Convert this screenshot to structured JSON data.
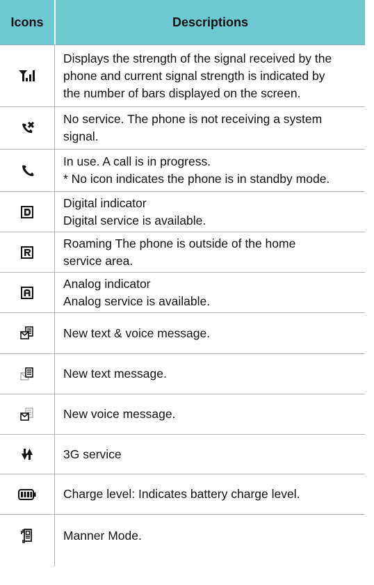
{
  "header": {
    "icons": "Icons",
    "descriptions": "Descriptions"
  },
  "rows": [
    {
      "icon": "signal-strength-icon",
      "lines": [
        "Displays the strength of the signal received by the",
        "phone and current signal strength is indicated by",
        "the number of bars displayed on the screen."
      ]
    },
    {
      "icon": "no-service-icon",
      "lines": [
        "No service. The phone is not receiving a system",
        "signal."
      ]
    },
    {
      "icon": "call-in-use-icon",
      "lines": [
        "In use. A call is in progress.",
        "* No icon indicates the phone is in standby mode."
      ]
    },
    {
      "icon": "digital-indicator-icon",
      "lines": [
        "Digital indicator",
        "Digital service is available."
      ]
    },
    {
      "icon": "roaming-icon",
      "lines": [
        "Roaming The phone is outside of the home",
        "service area."
      ]
    },
    {
      "icon": "analog-indicator-icon",
      "lines": [
        "Analog indicator",
        "Analog service is available."
      ]
    },
    {
      "icon": "text-voice-message-icon",
      "lines": [
        "New text & voice message."
      ]
    },
    {
      "icon": "text-message-icon",
      "lines": [
        "New text message."
      ]
    },
    {
      "icon": "voice-message-icon",
      "lines": [
        "New voice message."
      ]
    },
    {
      "icon": "3g-service-icon",
      "lines": [
        "3G service"
      ]
    },
    {
      "icon": "battery-charge-icon",
      "lines": [
        "Charge level: Indicates battery charge level."
      ]
    },
    {
      "icon": "manner-mode-icon",
      "lines": [
        "Manner Mode."
      ]
    }
  ],
  "colors": {
    "header_bg": "#6ec8cf",
    "rule": "#b5b5b5"
  }
}
